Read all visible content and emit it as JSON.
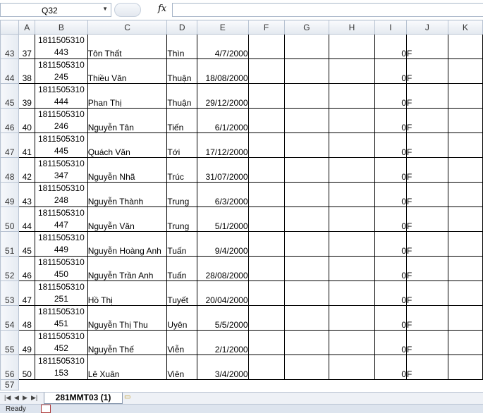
{
  "formula_bar": {
    "name_box": "Q32",
    "fx_label": "fx",
    "formula": ""
  },
  "columns": [
    "A",
    "B",
    "C",
    "D",
    "E",
    "F",
    "G",
    "H",
    "I",
    "J",
    "K"
  ],
  "rows": [
    {
      "row": "43",
      "a": "37",
      "b1": "1811505310",
      "b2": "443",
      "c": "Tôn Thất",
      "d": "Thìn",
      "e": "4/7/2000",
      "i": "0",
      "j": "F"
    },
    {
      "row": "44",
      "a": "38",
      "b1": "1811505310",
      "b2": "245",
      "c": "Thiều Văn",
      "d": "Thuận",
      "e": "18/08/2000",
      "i": "0",
      "j": "F"
    },
    {
      "row": "45",
      "a": "39",
      "b1": "1811505310",
      "b2": "444",
      "c": "Phan Thị",
      "d": "Thuận",
      "e": "29/12/2000",
      "i": "0",
      "j": "F"
    },
    {
      "row": "46",
      "a": "40",
      "b1": "1811505310",
      "b2": "246",
      "c": "Nguyễn Tân",
      "d": "Tiến",
      "e": "6/1/2000",
      "i": "0",
      "j": "F"
    },
    {
      "row": "47",
      "a": "41",
      "b1": "1811505310",
      "b2": "445",
      "c": "Quách Văn",
      "d": "Tới",
      "e": "17/12/2000",
      "i": "0",
      "j": "F"
    },
    {
      "row": "48",
      "a": "42",
      "b1": "1811505310",
      "b2": "347",
      "c": "Nguyễn Nhã",
      "d": "Trúc",
      "e": "31/07/2000",
      "i": "0",
      "j": "F"
    },
    {
      "row": "49",
      "a": "43",
      "b1": "1811505310",
      "b2": "248",
      "c": "Nguyễn Thành",
      "d": "Trung",
      "e": "6/3/2000",
      "i": "0",
      "j": "F"
    },
    {
      "row": "50",
      "a": "44",
      "b1": "1811505310",
      "b2": "447",
      "c": "Nguyễn Văn",
      "d": "Trung",
      "e": "5/1/2000",
      "i": "0",
      "j": "F"
    },
    {
      "row": "51",
      "a": "45",
      "b1": "1811505310",
      "b2": "449",
      "c": "Nguyễn Hoàng Anh",
      "d": "Tuấn",
      "e": "9/4/2000",
      "i": "0",
      "j": "F"
    },
    {
      "row": "52",
      "a": "46",
      "b1": "1811505310",
      "b2": "450",
      "c": "Nguyễn Trần Anh",
      "d": "Tuấn",
      "e": "28/08/2000",
      "i": "0",
      "j": "F"
    },
    {
      "row": "53",
      "a": "47",
      "b1": "1811505310",
      "b2": "251",
      "c": "Hồ Thị",
      "d": "Tuyết",
      "e": "20/04/2000",
      "i": "0",
      "j": "F"
    },
    {
      "row": "54",
      "a": "48",
      "b1": "1811505310",
      "b2": "451",
      "c": "Nguyễn Thị Thu",
      "d": "Uyên",
      "e": "5/5/2000",
      "i": "0",
      "j": "F"
    },
    {
      "row": "55",
      "a": "49",
      "b1": "1811505310",
      "b2": "452",
      "c": "Nguyễn Thế",
      "d": "Viễn",
      "e": "2/1/2000",
      "i": "0",
      "j": "F"
    },
    {
      "row": "56",
      "a": "50",
      "b1": "1811505310",
      "b2": "153",
      "c": "Lê Xuân",
      "d": "Viên",
      "e": "3/4/2000",
      "i": "0",
      "j": "F"
    }
  ],
  "last_row_label": "57",
  "sheet_tabs": {
    "active": "281MMT03 (1)"
  },
  "status_bar": {
    "ready": "Ready"
  }
}
